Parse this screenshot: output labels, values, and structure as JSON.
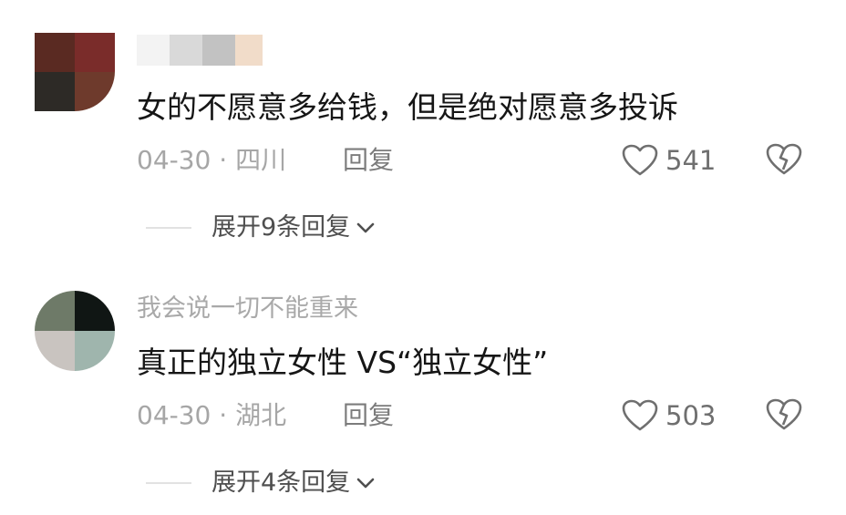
{
  "comments": [
    {
      "username": "",
      "content": "女的不愿意多给钱，但是绝对愿意多投诉",
      "date": "04-30",
      "separator": "·",
      "location": "四川",
      "reply_label": "回复",
      "likes": "541",
      "expand_label": "展开9条回复",
      "icons": {
        "like": "heart-outline-icon",
        "dislike": "broken-heart-icon",
        "expand": "chevron-down-icon"
      }
    },
    {
      "username": "我会说一切不能重来",
      "content": "真正的独立女性 VS“独立女性”",
      "date": "04-30",
      "separator": "·",
      "location": "湖北",
      "reply_label": "回复",
      "likes": "503",
      "expand_label": "展开4条回复",
      "icons": {
        "like": "heart-outline-icon",
        "dislike": "broken-heart-icon",
        "expand": "chevron-down-icon"
      }
    }
  ],
  "colors": {
    "text_primary": "#161616",
    "text_secondary": "#a6a6a6",
    "reply": "#7c7c7c",
    "like_count": "#6f6f6f",
    "expand_text": "#4f4f4f"
  }
}
